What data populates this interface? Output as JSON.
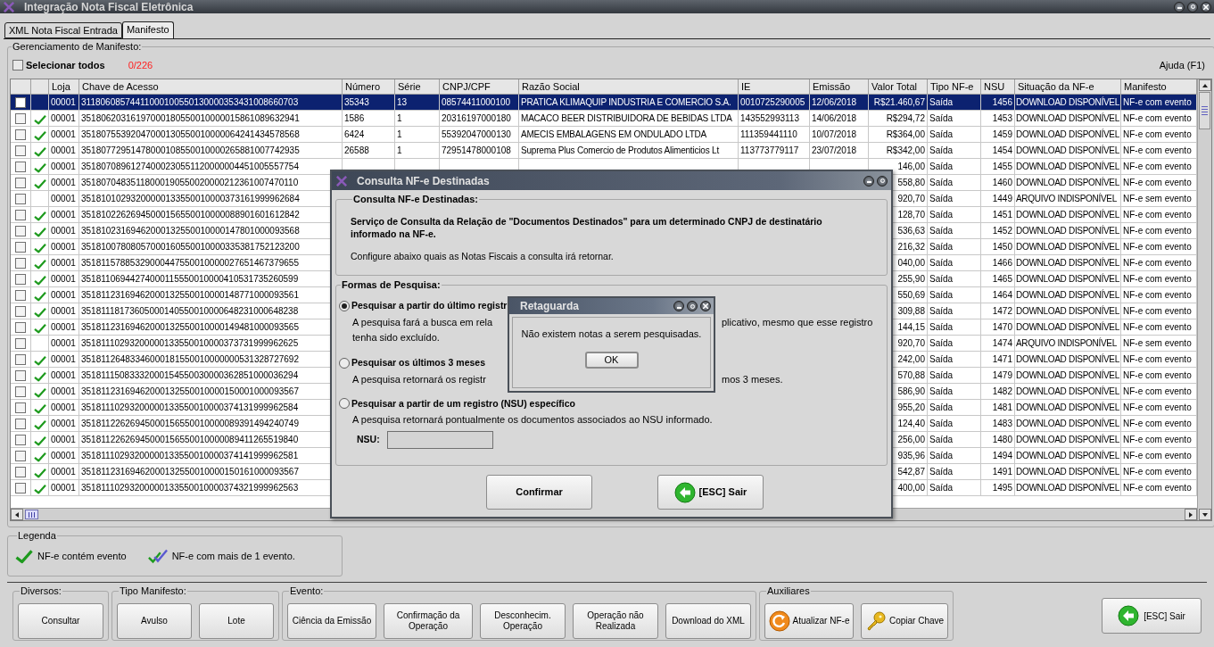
{
  "window": {
    "title": "Integração Nota Fiscal Eletrônica"
  },
  "tabs": [
    {
      "label": "XML Nota Fiscal Entrada",
      "selected": false
    },
    {
      "label": "Manifesto",
      "selected": true
    }
  ],
  "manager": {
    "title": "Gerenciamento de Manifesto:",
    "select_all": {
      "label": "Selecionar todos",
      "checked": false
    },
    "count": "0/226",
    "help": "Ajuda (F1)"
  },
  "table": {
    "columns": [
      "Loja",
      "Chave de Acesso",
      "Número",
      "Série",
      "CNPJ/CPF",
      "Razão Social",
      "IE",
      "Emissão",
      "Valor Total",
      "Tipo NF-e",
      "NSU",
      "Situação da NF-e",
      "Manifesto"
    ],
    "rows": [
      {
        "selected": true,
        "checked": false,
        "event": false,
        "loja": "00001",
        "chave": "31180608574411000100550130000353431008660703",
        "numero": "35343",
        "serie": "13",
        "cnpj": "08574411000100",
        "razao": "PRATICA KLIMAQUIP INDUSTRIA E COMERCIO S.A.",
        "ie": "0010725290005",
        "emissao": "12/06/2018",
        "valor": "R$21.460,67",
        "tipo": "Saída",
        "nsu": "1456",
        "situacao": "DOWNLOAD DISPONÍVEL",
        "manifesto": "NF-e com evento"
      },
      {
        "selected": false,
        "checked": false,
        "event": true,
        "loja": "00001",
        "chave": "35180620316197000180550010000015861089632941",
        "numero": "1586",
        "serie": "1",
        "cnpj": "20316197000180",
        "razao": "MACACO BEER DISTRIBUIDORA DE BEBIDAS LTDA",
        "ie": "143552993113",
        "emissao": "14/06/2018",
        "valor": "R$294,72",
        "tipo": "Saída",
        "nsu": "1453",
        "situacao": "DOWNLOAD DISPONÍVEL",
        "manifesto": "NF-e com evento"
      },
      {
        "selected": false,
        "checked": false,
        "event": true,
        "loja": "00001",
        "chave": "35180755392047000130550010000064241434578568",
        "numero": "6424",
        "serie": "1",
        "cnpj": "55392047000130",
        "razao": "AMECIS EMBALAGENS EM ONDULADO LTDA",
        "ie": "111359441110",
        "emissao": "10/07/2018",
        "valor": "R$364,00",
        "tipo": "Saída",
        "nsu": "1459",
        "situacao": "DOWNLOAD DISPONÍVEL",
        "manifesto": "NF-e com evento"
      },
      {
        "selected": false,
        "checked": false,
        "event": true,
        "loja": "00001",
        "chave": "35180772951478000108550010000265881007742935",
        "numero": "26588",
        "serie": "1",
        "cnpj": "72951478000108",
        "razao": "Suprema Plus Comercio de Produtos Alimenticios Lt",
        "ie": "113773779117",
        "emissao": "23/07/2018",
        "valor": "R$342,00",
        "tipo": "Saída",
        "nsu": "1454",
        "situacao": "DOWNLOAD DISPONÍVEL",
        "manifesto": "NF-e com evento"
      },
      {
        "selected": false,
        "checked": false,
        "event": true,
        "loja": "00001",
        "chave": "35180708961274000230551120000004451005557754",
        "valor": "146,00",
        "tipo": "Saída",
        "nsu": "1455",
        "situacao": "DOWNLOAD DISPONÍVEL",
        "manifesto": "NF-e com evento"
      },
      {
        "selected": false,
        "checked": false,
        "event": true,
        "loja": "00001",
        "chave": "35180704835118000190550020000212361007470110",
        "valor": "558,80",
        "tipo": "Saída",
        "nsu": "1460",
        "situacao": "DOWNLOAD DISPONÍVEL",
        "manifesto": "NF-e com evento"
      },
      {
        "selected": false,
        "checked": false,
        "event": false,
        "loja": "00001",
        "chave": "35181010293200000133550010000373161999962684",
        "valor": "920,70",
        "tipo": "Saída",
        "nsu": "1449",
        "situacao": "ARQUIVO INDISPONÍVEL",
        "manifesto": "NF-e sem evento"
      },
      {
        "selected": false,
        "checked": false,
        "event": true,
        "loja": "00001",
        "chave": "35181022626945000156550010000088901601612842",
        "valor": "128,70",
        "tipo": "Saída",
        "nsu": "1451",
        "situacao": "DOWNLOAD DISPONÍVEL",
        "manifesto": "NF-e com evento"
      },
      {
        "selected": false,
        "checked": false,
        "event": true,
        "loja": "00001",
        "chave": "35181023169462000132550010000147801000093568",
        "valor": "536,63",
        "tipo": "Saída",
        "nsu": "1452",
        "situacao": "DOWNLOAD DISPONÍVEL",
        "manifesto": "NF-e com evento"
      },
      {
        "selected": false,
        "checked": false,
        "event": true,
        "loja": "00001",
        "chave": "35181007808057000160550010000335381752123200",
        "valor": "216,32",
        "tipo": "Saída",
        "nsu": "1450",
        "situacao": "DOWNLOAD DISPONÍVEL",
        "manifesto": "NF-e com evento"
      },
      {
        "selected": false,
        "checked": false,
        "event": true,
        "loja": "00001",
        "chave": "35181157885329000447550010000027651467379655",
        "valor": "040,00",
        "tipo": "Saída",
        "nsu": "1466",
        "situacao": "DOWNLOAD DISPONÍVEL",
        "manifesto": "NF-e com evento"
      },
      {
        "selected": false,
        "checked": false,
        "event": true,
        "loja": "00001",
        "chave": "35181106944274000115550010000410531735260599",
        "valor": "255,90",
        "tipo": "Saída",
        "nsu": "1465",
        "situacao": "DOWNLOAD DISPONÍVEL",
        "manifesto": "NF-e com evento"
      },
      {
        "selected": false,
        "checked": false,
        "event": true,
        "loja": "00001",
        "chave": "35181123169462000132550010000148771000093561",
        "valor": "550,69",
        "tipo": "Saída",
        "nsu": "1464",
        "situacao": "DOWNLOAD DISPONÍVEL",
        "manifesto": "NF-e com evento"
      },
      {
        "selected": false,
        "checked": false,
        "event": true,
        "loja": "00001",
        "chave": "35181118173605000140550010000648231000648238",
        "valor": "309,88",
        "tipo": "Saída",
        "nsu": "1472",
        "situacao": "DOWNLOAD DISPONÍVEL",
        "manifesto": "NF-e com evento"
      },
      {
        "selected": false,
        "checked": false,
        "event": true,
        "loja": "00001",
        "chave": "35181123169462000132550010000149481000093565",
        "valor": "144,15",
        "tipo": "Saída",
        "nsu": "1470",
        "situacao": "DOWNLOAD DISPONÍVEL",
        "manifesto": "NF-e com evento"
      },
      {
        "selected": false,
        "checked": false,
        "event": false,
        "loja": "00001",
        "chave": "35181110293200000133550010000373731999962625",
        "valor": "920,70",
        "tipo": "Saída",
        "nsu": "1474",
        "situacao": "ARQUIVO INDISPONÍVEL",
        "manifesto": "NF-e sem evento"
      },
      {
        "selected": false,
        "checked": false,
        "event": true,
        "loja": "00001",
        "chave": "35181126483346000181550010000000531328727692",
        "valor": "242,00",
        "tipo": "Saída",
        "nsu": "1471",
        "situacao": "DOWNLOAD DISPONÍVEL",
        "manifesto": "NF-e com evento"
      },
      {
        "selected": false,
        "checked": false,
        "event": true,
        "loja": "00001",
        "chave": "35181115083332000154550030000362851000036294",
        "valor": "570,88",
        "tipo": "Saída",
        "nsu": "1479",
        "situacao": "DOWNLOAD DISPONÍVEL",
        "manifesto": "NF-e com evento"
      },
      {
        "selected": false,
        "checked": false,
        "event": true,
        "loja": "00001",
        "chave": "35181123169462000132550010000150001000093567",
        "valor": "586,90",
        "tipo": "Saída",
        "nsu": "1482",
        "situacao": "DOWNLOAD DISPONÍVEL",
        "manifesto": "NF-e com evento"
      },
      {
        "selected": false,
        "checked": false,
        "event": true,
        "loja": "00001",
        "chave": "35181110293200000133550010000374131999962584",
        "valor": "955,20",
        "tipo": "Saída",
        "nsu": "1481",
        "situacao": "DOWNLOAD DISPONÍVEL",
        "manifesto": "NF-e com evento"
      },
      {
        "selected": false,
        "checked": false,
        "event": true,
        "loja": "00001",
        "chave": "35181122626945000156550010000089391494240749",
        "valor": "124,40",
        "tipo": "Saída",
        "nsu": "1483",
        "situacao": "DOWNLOAD DISPONÍVEL",
        "manifesto": "NF-e com evento"
      },
      {
        "selected": false,
        "checked": false,
        "event": true,
        "loja": "00001",
        "chave": "35181122626945000156550010000089411265519840",
        "valor": "256,00",
        "tipo": "Saída",
        "nsu": "1480",
        "situacao": "DOWNLOAD DISPONÍVEL",
        "manifesto": "NF-e com evento"
      },
      {
        "selected": false,
        "checked": false,
        "event": true,
        "loja": "00001",
        "chave": "35181110293200000133550010000374141999962581",
        "valor": "935,96",
        "tipo": "Saída",
        "nsu": "1494",
        "situacao": "DOWNLOAD DISPONÍVEL",
        "manifesto": "NF-e com evento"
      },
      {
        "selected": false,
        "checked": false,
        "event": true,
        "loja": "00001",
        "chave": "35181123169462000132550010000150161000093567",
        "valor": "542,87",
        "tipo": "Saída",
        "nsu": "1491",
        "situacao": "DOWNLOAD DISPONÍVEL",
        "manifesto": "NF-e com evento"
      },
      {
        "selected": false,
        "checked": false,
        "event": true,
        "loja": "00001",
        "chave": "35181110293200000133550010000374321999962563",
        "valor": "400,00",
        "tipo": "Saída",
        "nsu": "1495",
        "situacao": "DOWNLOAD DISPONÍVEL",
        "manifesto": "NF-e com evento"
      }
    ]
  },
  "legend": {
    "title": "Legenda",
    "items": [
      {
        "label": "NF-e contém evento"
      },
      {
        "label": "NF-e com mais de 1 evento."
      }
    ]
  },
  "toolbar": [
    {
      "title": "Diversos:",
      "buttons": [
        {
          "label": "Consultar"
        }
      ]
    },
    {
      "title": "Tipo Manifesto:",
      "buttons": [
        {
          "label": "Avulso"
        },
        {
          "label": "Lote"
        }
      ]
    },
    {
      "title": "Evento:",
      "buttons": [
        {
          "label": "Ciência da Emissão"
        },
        {
          "label": "Confirmação da Operação"
        },
        {
          "label": "Desconhecim. Operação"
        },
        {
          "label": "Operação não Realizada"
        },
        {
          "label": "Download do XML"
        }
      ]
    },
    {
      "title": "Auxiliares",
      "buttons": [
        {
          "label": "Atualizar NF-e"
        },
        {
          "label": "Copiar Chave"
        }
      ]
    }
  ],
  "exit_button": "[ESC] Sair",
  "dialog": {
    "title": "Consulta NF-e Destinadas",
    "section_title": "Consulta NF-e Destinadas:",
    "description": "Serviço de Consulta da Relação de \"Documentos Destinados\" para um determinado CNPJ de destinatário informado na NF-e.",
    "note": "Configure abaixo quais as Notas Fiscais a consulta irá retornar.",
    "search_title": "Formas de Pesquisa:",
    "options": [
      {
        "label": "Pesquisar a partir do último registr",
        "selected": true,
        "lines": [
          {
            "left": "A pesquisa fará a busca em rela",
            "right": "plicativo, mesmo que esse registro"
          },
          {
            "left": "tenha sido excluído."
          }
        ]
      },
      {
        "label": "Pesquisar os últimos 3 meses",
        "selected": false,
        "lines": [
          {
            "left": "A pesquisa retornará os registr",
            "right": "mos 3 meses."
          }
        ]
      },
      {
        "label": "Pesquisar a partir de um registro (NSU) específico",
        "selected": false,
        "lines": [
          {
            "left": "A pesquisa retornará pontualmente os documentos associados ao NSU informado."
          }
        ]
      }
    ],
    "nsu_label": "NSU:",
    "buttons": [
      "Confirmar",
      "[ESC] Sair"
    ]
  },
  "message": {
    "title": "Retaguarda",
    "text": "Não existem notas a serem pesquisadas.",
    "button": "OK"
  }
}
